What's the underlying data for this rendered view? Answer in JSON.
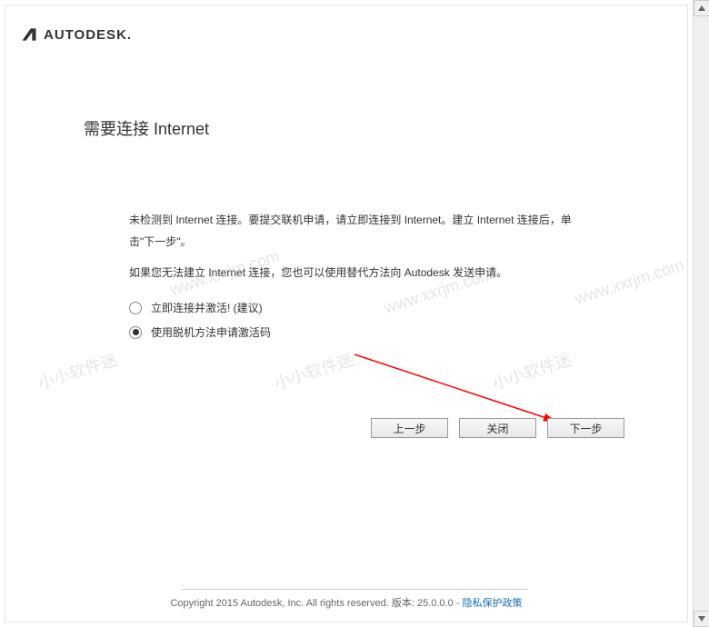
{
  "logo": {
    "text": "AUTODESK."
  },
  "heading": "需要连接 Internet",
  "paragraphs": {
    "p1": "未检测到 Internet 连接。要提交联机申请，请立即连接到 Internet。建立 Internet 连接后，单击\"下一步\"。",
    "p2": "如果您无法建立 Internet 连接，您也可以使用替代方法向 Autodesk 发送申请。"
  },
  "radio": {
    "option1": "立即连接并激活! (建议)",
    "option2": "使用脱机方法申请激活码",
    "selected": "option2"
  },
  "buttons": {
    "back": "上一步",
    "close": "关闭",
    "next": "下一步"
  },
  "footer": {
    "copyright": "Copyright 2015 Autodesk, Inc. All rights reserved.",
    "version_label": "版本:",
    "version": "25.0.0.0",
    "separator": "-",
    "privacy_link": "隐私保护政策"
  },
  "watermarks": {
    "text_cn": "小小软件迷",
    "text_url": "www.xxrjm.com"
  }
}
